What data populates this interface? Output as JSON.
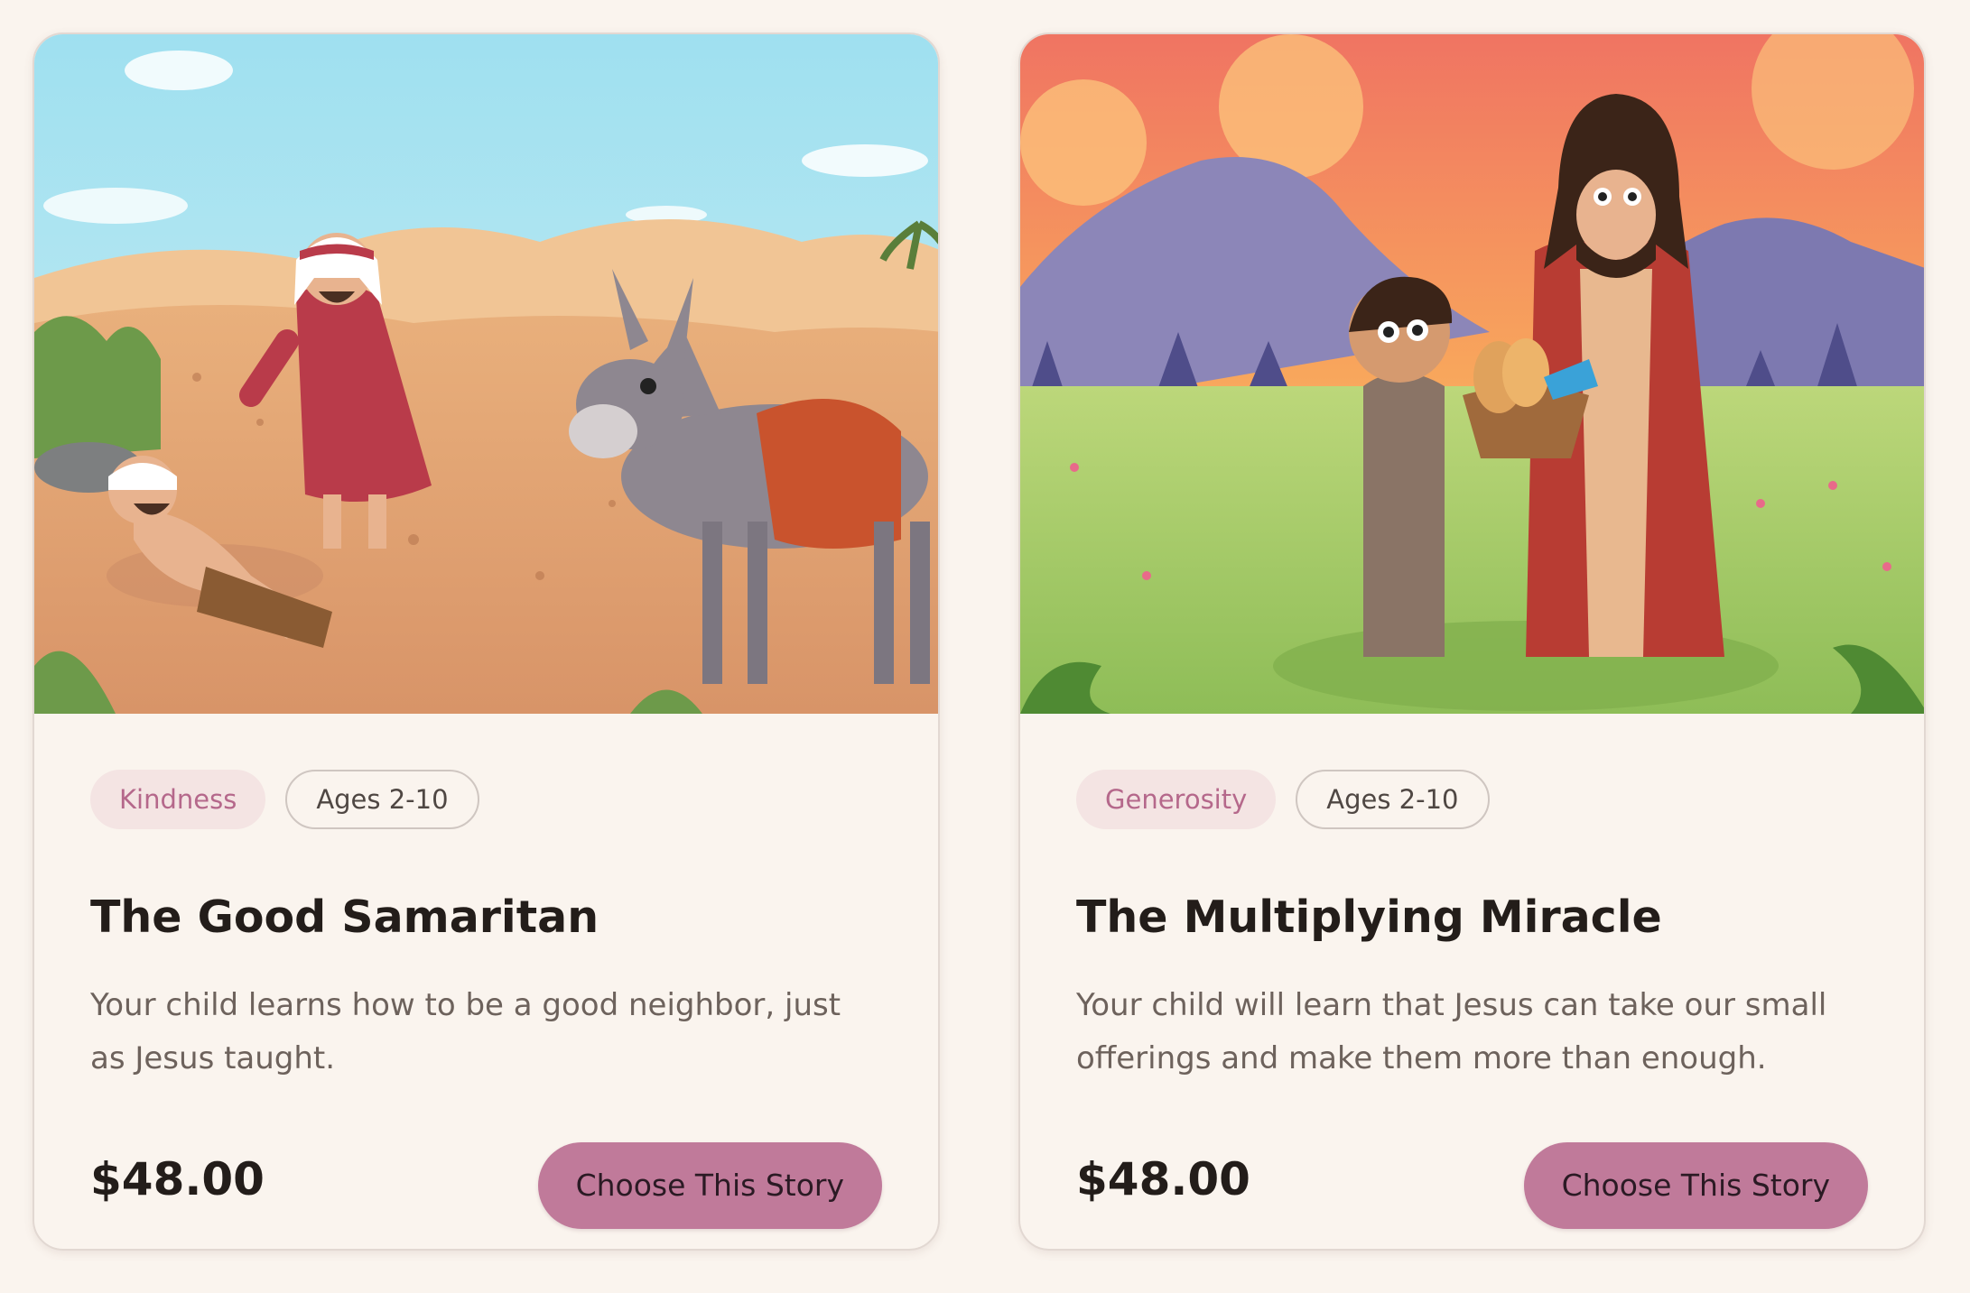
{
  "products": [
    {
      "image_alt": "Illustration of the Good Samaritan story in a desert with a donkey",
      "tags": {
        "theme": "Kindness",
        "age": "Ages 2-10"
      },
      "title": "The Good Samaritan",
      "description": "Your child learns how to be a good neighbor, just as Jesus taught.",
      "price": "$48.00",
      "button_label": "Choose This Story"
    },
    {
      "image_alt": "Illustration of a child offering a basket of bread and fish to Jesus on a grassy hill at sunset",
      "tags": {
        "theme": "Generosity",
        "age": "Ages 2-10"
      },
      "title": "The Multiplying Miracle",
      "description": "Your child will learn that Jesus can take our small offerings and make them more than enough.",
      "price": "$48.00",
      "button_label": "Choose This Story"
    }
  ],
  "colors": {
    "background": "#faf4ee",
    "button": "#c07a9a",
    "theme_tag_bg": "#f4e4e3",
    "theme_tag_text": "#b5688b"
  }
}
